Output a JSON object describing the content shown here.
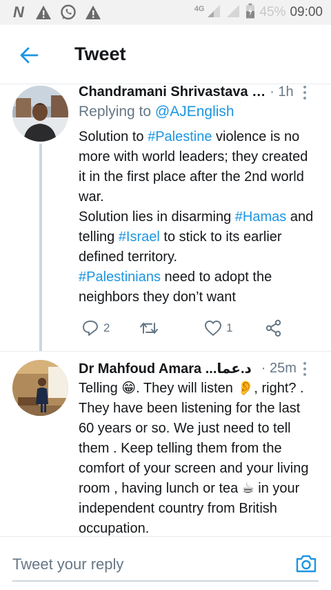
{
  "status_bar": {
    "network": "4G",
    "battery_percent": "45%",
    "time": "09:00",
    "notification_icons": [
      "n-app-icon",
      "alert-icon",
      "whatsapp-icon",
      "alert-icon"
    ]
  },
  "header": {
    "title": "Tweet"
  },
  "tweets": [
    {
      "author": "Chandramani Shrivastava …",
      "time": "· 1h",
      "replying_label": "Replying to",
      "replying_handle": "@AJEnglish",
      "body": {
        "t1": "Solution to ",
        "h1": "#Palestine",
        "t2": " violence is no more with world leaders; they created it in the first place after the 2nd world war.",
        "t3": "Solution lies in disarming ",
        "h2": "#Hamas",
        "t4": " and telling ",
        "h3": "#Israel",
        "t5": " to stick to its earlier defined territory.",
        "h4": "#Palestinians",
        "t6": " need to adopt the neighbors they don’t want"
      },
      "reply_count": "2",
      "like_count": "1"
    },
    {
      "author": "Dr Mahfoud Amara ...د.عما",
      "time": "· 25m",
      "body": {
        "t1": "Telling 😁. They will listen 👂, right? . They have been listening for the last 60 years or so. We just need to tell them . Keep telling them from the comfort of your screen and your living room , having lunch  or tea ☕ in your independent country from British occupation."
      }
    }
  ],
  "composer": {
    "placeholder": "Tweet your reply"
  },
  "colors": {
    "accent": "#1b95e0",
    "text_primary": "#14171a",
    "text_secondary": "#657786",
    "divider": "#e6ecf0"
  }
}
